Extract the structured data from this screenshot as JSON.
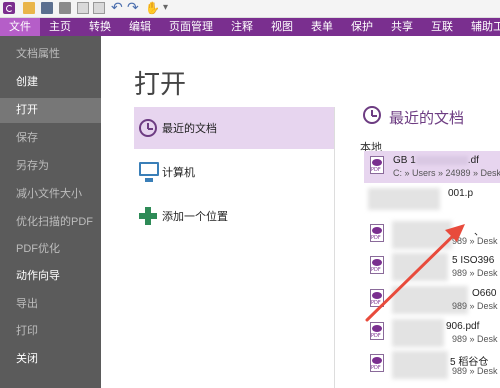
{
  "toolbar": {
    "icons": [
      "app-logo-icon",
      "open-icon",
      "save-icon",
      "print-icon",
      "copy-icon",
      "paste-icon",
      "undo-icon",
      "redo-icon",
      "hand-tool-icon",
      "more-icon"
    ],
    "undo_glyph": "↶",
    "redo_glyph": "↷",
    "hand_glyph": "✋",
    "more_glyph": "▾"
  },
  "ribbon": {
    "tabs": [
      "文件",
      "主页",
      "转换",
      "编辑",
      "页面管理",
      "注释",
      "视图",
      "表单",
      "保护",
      "共享",
      "互联",
      "辅助工具"
    ],
    "active": "文件",
    "active_color": "#b55ec8",
    "bar_color": "#7a2f8f"
  },
  "sidebar": {
    "items": [
      "文档属性",
      "创建",
      "打开",
      "保存",
      "另存为",
      "减小文件大小",
      "优化扫描的PDF",
      "PDF优化",
      "动作向导",
      "导出",
      "打印",
      "关闭"
    ],
    "active": "打开"
  },
  "main": {
    "title": "打开",
    "places": [
      "最近的文档",
      "计算机",
      "添加一个位置"
    ],
    "recent_title": "最近的文档",
    "local_label": "本地",
    "docs": [
      {
        "name": "GB 1",
        "name_suffix": ".df",
        "path": "C: » Users » 24989 » Desk"
      },
      {
        "name": "",
        "name_suffix": "001.p",
        "path": ""
      },
      {
        "name": "",
        "name_suffix": "、",
        "path": "989 » Desk"
      },
      {
        "name": "",
        "name_suffix": "5 ISO396",
        "path": "989 » Desk"
      },
      {
        "name": "",
        "name_suffix": "O660",
        "path": "989 » Desk"
      },
      {
        "name": "",
        "name_suffix": "906.pdf",
        "path": "989 » Desk"
      },
      {
        "name": "",
        "name_suffix": "5 稻谷仓",
        "path": "989 » Desk"
      }
    ]
  },
  "colors": {
    "accent": "#7a2f8f",
    "highlight": "#e7d5ef",
    "sidebar_bg": "#5b5b5b",
    "arrow": "#e84b3c"
  }
}
